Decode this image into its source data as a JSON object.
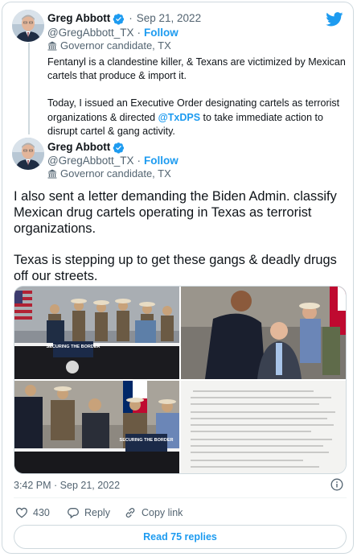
{
  "quoted_tweet": {
    "author_name": "Greg Abbott",
    "handle": "@GregAbbott_TX",
    "separator": "·",
    "date": "Sep 21, 2022",
    "follow_label": "Follow",
    "account_label": "Governor candidate, TX",
    "paragraphs": [
      "Fentanyl is a clandestine killer, & Texans are victimized by Mexican cartels that produce & import it.",
      "Today, I issued an Executive Order designating cartels as terrorist organizations & directed"
    ],
    "mention": "@TxDPS",
    "mention_suffix": " to take immediate action to disrupt cartel & gang activity."
  },
  "main_tweet": {
    "author_name": "Greg Abbott",
    "handle": "@GregAbbott_TX",
    "separator": "·",
    "follow_label": "Follow",
    "account_label": "Governor candidate, TX",
    "paragraphs": [
      "I also sent a letter demanding the Biden Admin. classify Mexican drug cartels operating in Texas as terrorist organizations.",
      "Texas is stepping up to get these gangs & deadly drugs off our streets."
    ],
    "photo_signs": {
      "p1": "SECURING THE BORDER",
      "p3": "SECURING THE BORDER"
    },
    "timestamp": "3:42 PM · Sep 21, 2022"
  },
  "actions": {
    "like_count": "430",
    "reply_label": "Reply",
    "copy_link_label": "Copy link"
  },
  "read_replies_label": "Read 75 replies",
  "colors": {
    "accent": "#1d9bf0",
    "text": "#0f1419",
    "muted": "#536471",
    "border": "#cfd9de"
  }
}
